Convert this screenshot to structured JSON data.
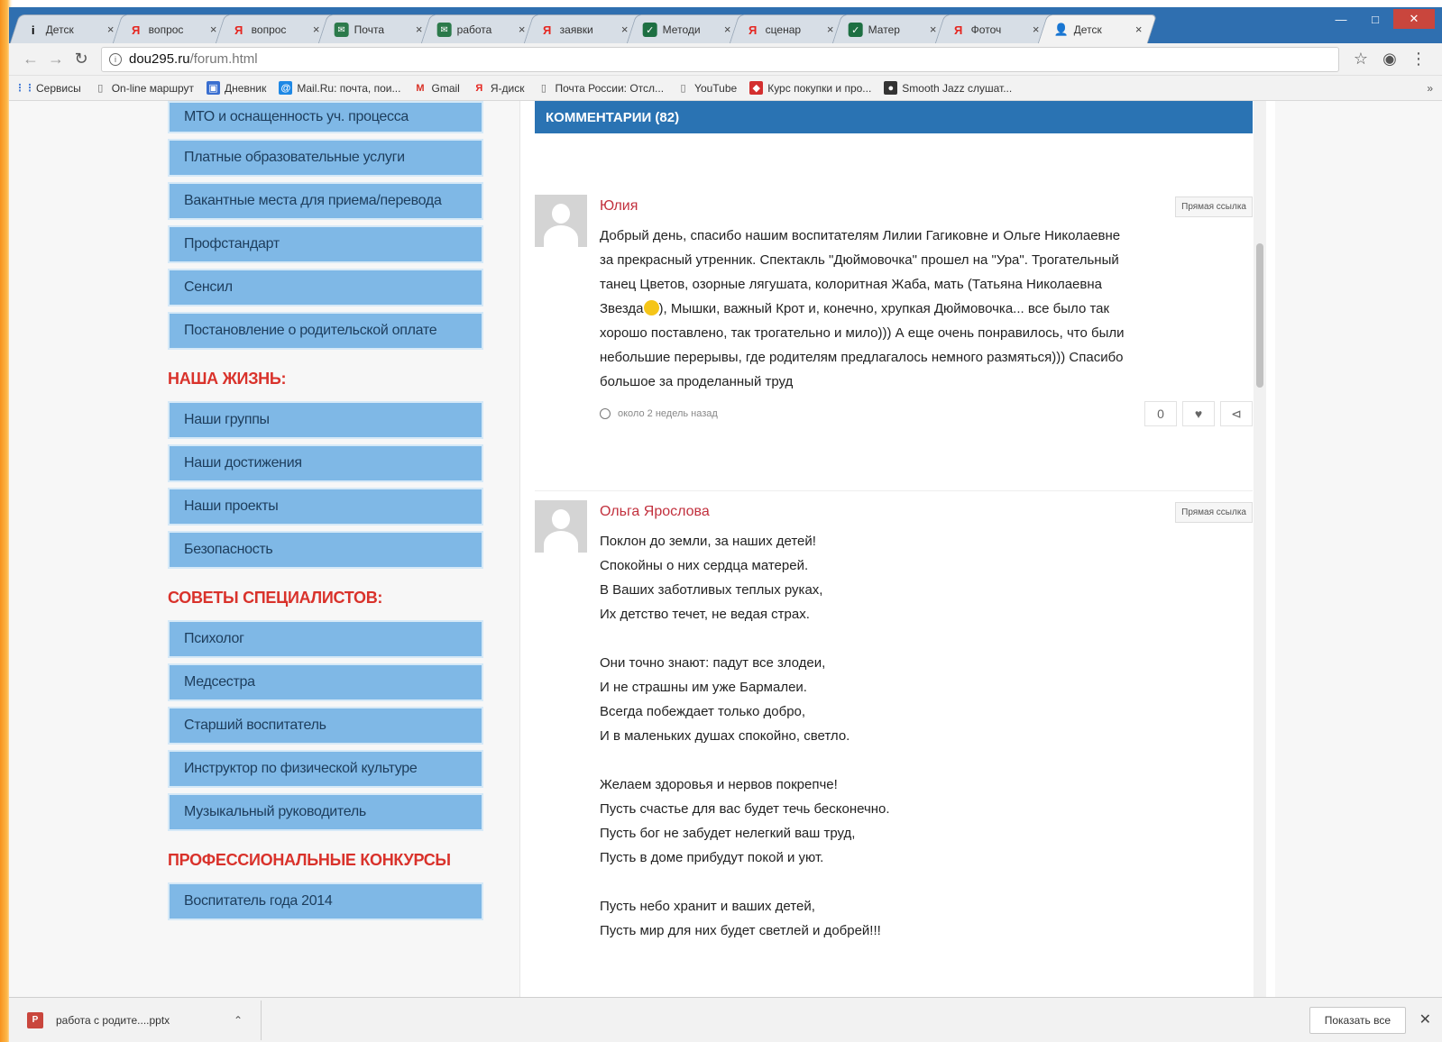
{
  "browser": {
    "tabs": [
      {
        "title": "Детск",
        "icon": "info",
        "active": false
      },
      {
        "title": "вопрос",
        "icon": "yandex",
        "active": false
      },
      {
        "title": "вопрос",
        "icon": "yandex",
        "active": false
      },
      {
        "title": "Почта",
        "icon": "mail",
        "active": false
      },
      {
        "title": "работа",
        "icon": "mail",
        "active": false
      },
      {
        "title": "заявки",
        "icon": "yandex",
        "active": false
      },
      {
        "title": "Методи",
        "icon": "check",
        "active": false
      },
      {
        "title": "сценар",
        "icon": "yandex",
        "active": false
      },
      {
        "title": "Матер",
        "icon": "check",
        "active": false
      },
      {
        "title": "Фоточ",
        "icon": "yandex",
        "active": false
      },
      {
        "title": "Детск",
        "icon": "person",
        "active": true
      }
    ],
    "url_host": "dou295.ru",
    "url_path": "/forum.html",
    "bookmarks": [
      {
        "label": "Сервисы",
        "icon": "apps"
      },
      {
        "label": "On-line маршрут",
        "icon": "doc"
      },
      {
        "label": "Дневник",
        "icon": "blue"
      },
      {
        "label": "Mail.Ru: почта, пои...",
        "icon": "mailru"
      },
      {
        "label": "Gmail",
        "icon": "gmail"
      },
      {
        "label": "Я-диск",
        "icon": "yandex"
      },
      {
        "label": "Почта России: Отсл...",
        "icon": "doc"
      },
      {
        "label": "YouTube",
        "icon": "doc"
      },
      {
        "label": "Курс покупки и про...",
        "icon": "red"
      },
      {
        "label": "Smooth Jazz слушат...",
        "icon": "dark"
      }
    ],
    "bookmarks_more": "»"
  },
  "sidebar": {
    "group1": [
      "МТО и оснащенность уч. процесса",
      "Платные образовательные услуги",
      "Вакантные места для приема/перевода",
      "Профстандарт",
      "Сенсил",
      "Постановление о родительской оплате"
    ],
    "section2_title": "НАША ЖИЗНЬ:",
    "group2": [
      "Наши группы",
      "Наши достижения",
      "Наши проекты",
      "Безопасность"
    ],
    "section3_title": "СОВЕТЫ СПЕЦИАЛИСТОВ:",
    "group3": [
      "Психолог",
      "Медсестра",
      "Старший воспитатель",
      "Инструктор по физической культуре",
      "Музыкальный руководитель"
    ],
    "section4_title": "ПРОФЕССИОНАЛЬНЫЕ КОНКУРСЫ",
    "group4": [
      "Воспитатель года 2014"
    ]
  },
  "comments": {
    "header": "КОММЕНТАРИИ (82)",
    "items": [
      {
        "author": "Юлия",
        "link": "Прямая ссылка",
        "text_lines": [
          "Добрый день, спасибо нашим воспитателям Лилии Гагиковне и Ольге Николаевне",
          "за прекрасный утренник. Спектакль \"Дюймовочка\" прошел на \"Ура\". Трогательный",
          "танец Цветов, озорные лягушата, колоритная Жаба, мать (Татьяна Николаевна",
          "Звезда",
          "), Мышки, важный Крот и, конечно, хрупкая Дюймовочка... все было так",
          "хорошо поставлено, так трогательно и мило))) А еще очень понравилось, что были",
          "небольшие перерывы, где родителям предлагалось немного размяться))) Спасибо",
          "большое за проделанный труд"
        ],
        "time": "около 2 недель назад",
        "reply_count": "0"
      },
      {
        "author": "Ольга Ярослова",
        "link": "Прямая ссылка",
        "stanzas": [
          [
            "Поклон до земли, за наших детей!",
            "Спокойны о них сердца матерей.",
            "В Ваших заботливых теплых руках,",
            "Их детство течет, не ведая страх."
          ],
          [
            "Они точно знают: падут все злодеи,",
            "И не страшны им уже Бармалеи.",
            "Всегда побеждает только добро,",
            "И в маленьких душах спокойно, светло."
          ],
          [
            "Желаем здоровья и нервов покрепче!",
            "Пусть счастье для вас будет течь бесконечно.",
            "Пусть бог не забудет нелегкий ваш труд,",
            "Пусть в доме прибудут покой и уют."
          ],
          [
            "Пусть небо хранит и ваших детей,",
            "Пусть мир для них будет светлей и добрей!!!"
          ]
        ]
      }
    ]
  },
  "downloads": {
    "file_name": "работа с родите....pptx",
    "show_all": "Показать все"
  }
}
